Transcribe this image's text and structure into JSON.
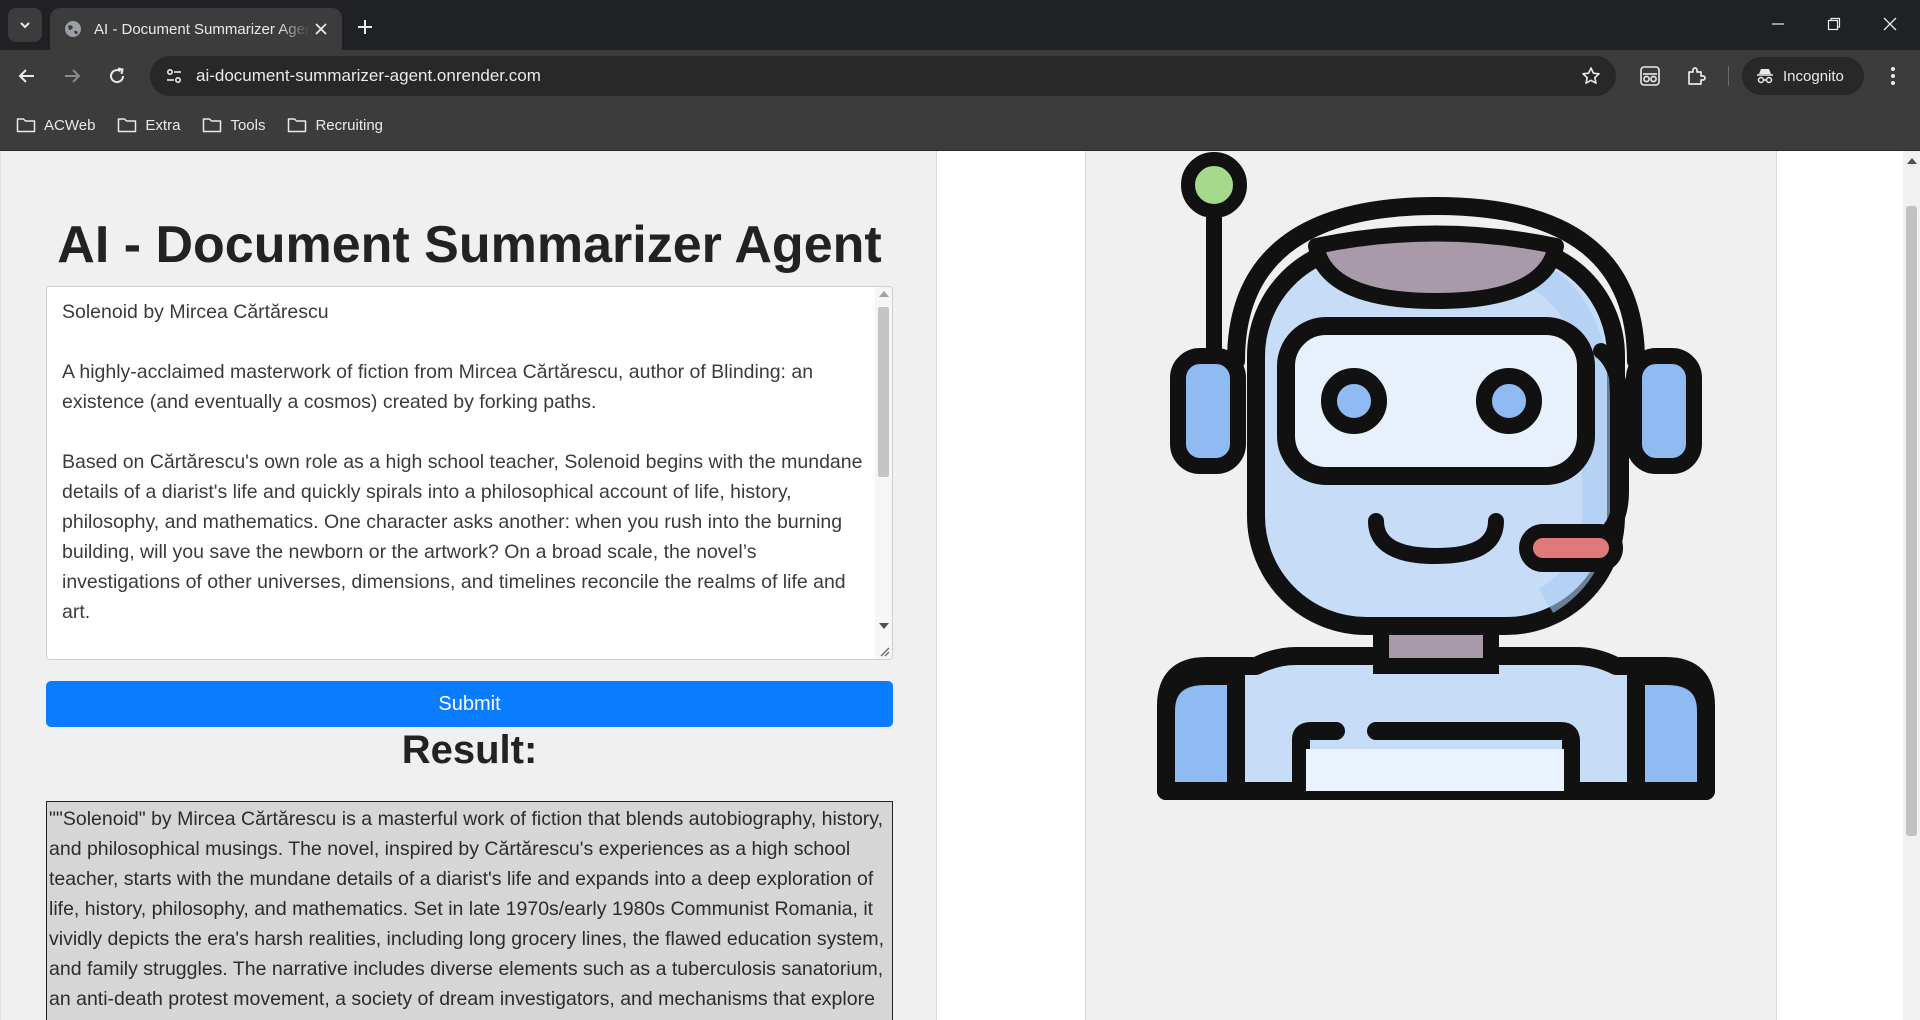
{
  "browser": {
    "tab_title": "AI - Document Summarizer Agent",
    "url": "ai-document-summarizer-agent.onrender.com",
    "incognito_label": "Incognito",
    "bookmarks": [
      "ACWeb",
      "Extra",
      "Tools",
      "Recruiting"
    ]
  },
  "page": {
    "title": "AI - Document Summarizer Agent",
    "input_text": "Solenoid by Mircea Cărtărescu\n\nA highly-acclaimed masterwork of fiction from Mircea Cărtărescu, author of Blinding: an existence (and eventually a cosmos) created by forking paths.\n\nBased on Cărtărescu's own role as a high school teacher, Solenoid begins with the mundane details of a diarist's life and quickly spirals into a philosophical account of life, history, philosophy, and mathematics. One character asks another: when you rush into the burning building, will you save the newborn or the artwork? On a broad scale, the novel’s investigations of other universes, dimensions, and timelines reconcile the realms of life and art.",
    "submit_label": "Submit",
    "result_label": "Result:",
    "result_text": "\"\"Solenoid\" by Mircea Cărtărescu is a masterful work of fiction that blends autobiography, history, and philosophical musings. The novel, inspired by Cărtărescu's experiences as a high school teacher, starts with the mundane details of a diarist's life and expands into a deep exploration of life, history, philosophy, and mathematics. Set in late 1970s/early 1980s Communist Romania, it vividly depicts the era's harsh realities, including long grocery lines, the flawed education system, and family struggles. The narrative includes diverse elements such as a tuberculosis sanatorium, an anti-death protest movement, a society of dream investigators, and mechanisms that explore the very fabric of reality."
  },
  "colors": {
    "submit_bg": "#0a7cff",
    "robot_outline": "#111111",
    "robot_face": "#c7dcf7",
    "robot_ears": "#8fbaf2",
    "robot_antenna_tip": "#a6d98c",
    "robot_mic": "#e07a7a",
    "robot_neck": "#a89aa8"
  }
}
